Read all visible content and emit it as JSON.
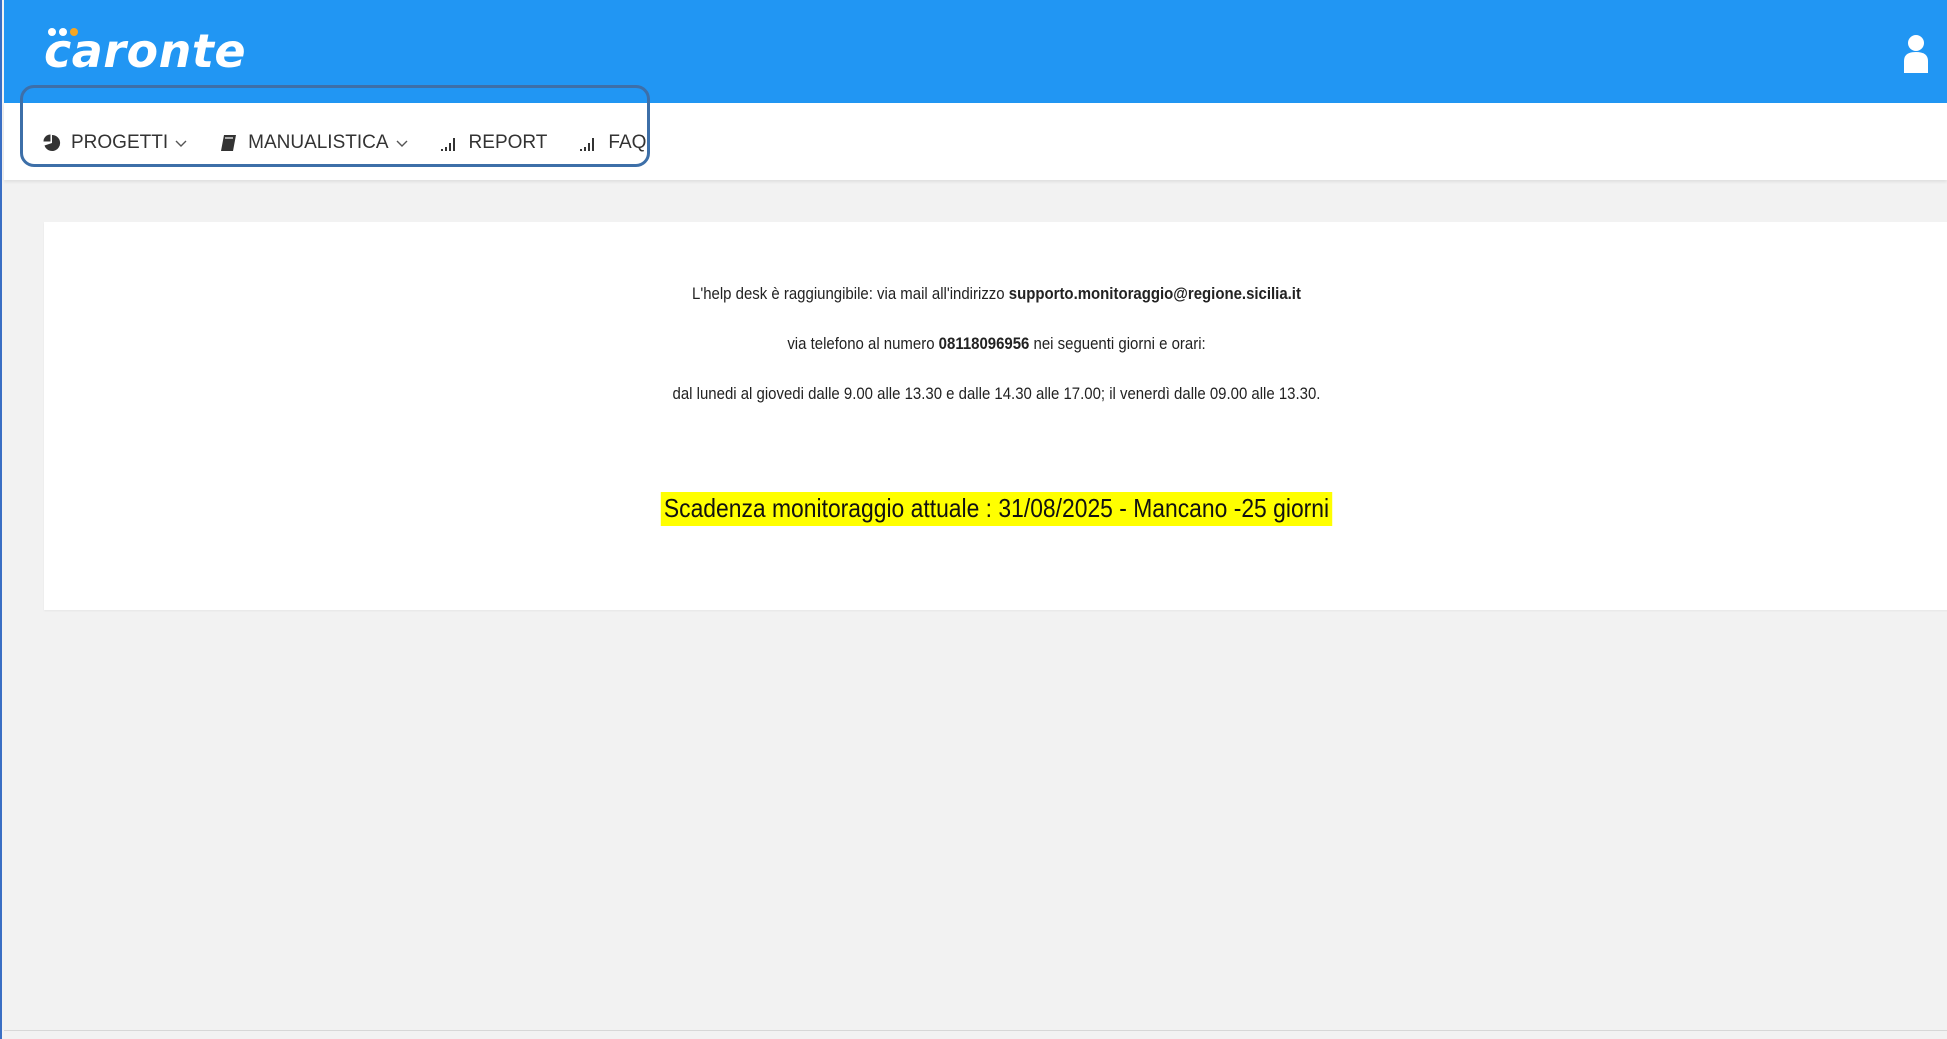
{
  "header": {
    "logo_text": "caronte",
    "brand_color": "#2196f3",
    "logo_dot_colors": [
      "#ffffff",
      "#ffffff",
      "#f5a623"
    ],
    "user_icon": "user-icon"
  },
  "nav": {
    "items": [
      {
        "label": "PROGETTI",
        "icon": "pie-chart-icon",
        "dropdown": true
      },
      {
        "label": "MANUALISTICA",
        "icon": "book-icon",
        "dropdown": true
      },
      {
        "label": "REPORT",
        "icon": "signal-bars-icon",
        "dropdown": false
      },
      {
        "label": "FAQ",
        "icon": "signal-bars-icon",
        "dropdown": false
      }
    ]
  },
  "helpdesk": {
    "line1_prefix": "L'help desk è raggiungibile: via mail all'indirizzo ",
    "email": "supporto.monitoraggio@regione.sicilia.it",
    "line2_prefix": "via telefono al numero ",
    "phone": "08118096956",
    "line2_suffix": " nei seguenti giorni e orari:",
    "line3": "dal lunedi al giovedi dalle 9.00 alle 13.30 e dalle 14.30 alle 17.00; il venerdì dalle 09.00 alle 13.30."
  },
  "deadline": {
    "text": "Scadenza monitoraggio attuale : 31/08/2025 - Mancano -25 giorni",
    "highlight_color": "#ffff00"
  }
}
